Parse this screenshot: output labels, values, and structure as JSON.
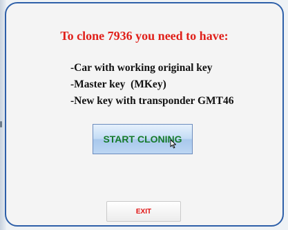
{
  "dialog": {
    "title": "To clone 7936 you need to have:",
    "requirements": [
      "-Car with working original key",
      "-Master key  (MKey)",
      "-New key with transponder GMT46"
    ],
    "start_button_label": "START CLONING",
    "exit_button_label": "EXIT"
  },
  "colors": {
    "title": "#e0201a",
    "panel_border": "#2d5fa8",
    "start_text": "#157a2a",
    "exit_text": "#e01010"
  },
  "icons": {
    "cursor": "mouse-pointer-icon"
  }
}
